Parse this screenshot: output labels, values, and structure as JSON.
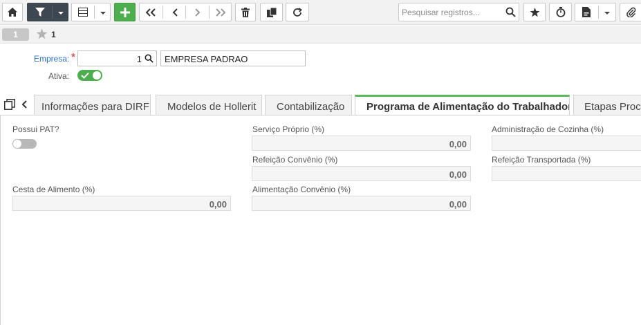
{
  "toolbar": {
    "search_placeholder": "Pesquisar registros..."
  },
  "record_nav": {
    "record_pill": "1",
    "record_number": "1"
  },
  "header": {
    "empresa_label": "Empresa:",
    "required_mark": "*",
    "empresa_code": "1",
    "empresa_name": "EMPRESA PADRAO",
    "ativa_label": "Ativa:",
    "ativa_on": true
  },
  "tabs": [
    {
      "label": "Informações para DIRF",
      "active": false
    },
    {
      "label": "Modelos de Hollerit",
      "active": false
    },
    {
      "label": "Contabilização",
      "active": false
    },
    {
      "label": "Programa de Alimentação do Trabalhador",
      "active": true
    },
    {
      "label": "Etapas Proce",
      "active": false
    }
  ],
  "pat_form": {
    "possui_pat_label": "Possui PAT?",
    "possui_pat_on": false,
    "servico_proprio_label": "Serviço Próprio (%)",
    "servico_proprio_value": "0,00",
    "administracao_cozinha_label": "Administração de Cozinha (%)",
    "administracao_cozinha_value": "",
    "refeicao_convenio_label": "Refeição Convênio (%)",
    "refeicao_convenio_value": "0,00",
    "refeicao_transportada_label": "Refeição Transportada (%)",
    "refeicao_transportada_value": "",
    "cesta_alimento_label": "Cesta de Alimento (%)",
    "cesta_alimento_value": "0,00",
    "alimentacao_convenio_label": "Alimentação Convênio (%)",
    "alimentacao_convenio_value": "0,00"
  },
  "colors": {
    "accent_green": "#4cae4c",
    "toolbar_dark": "#3d4752",
    "link_blue": "#2a6fc9",
    "required_red": "#d9534f"
  }
}
